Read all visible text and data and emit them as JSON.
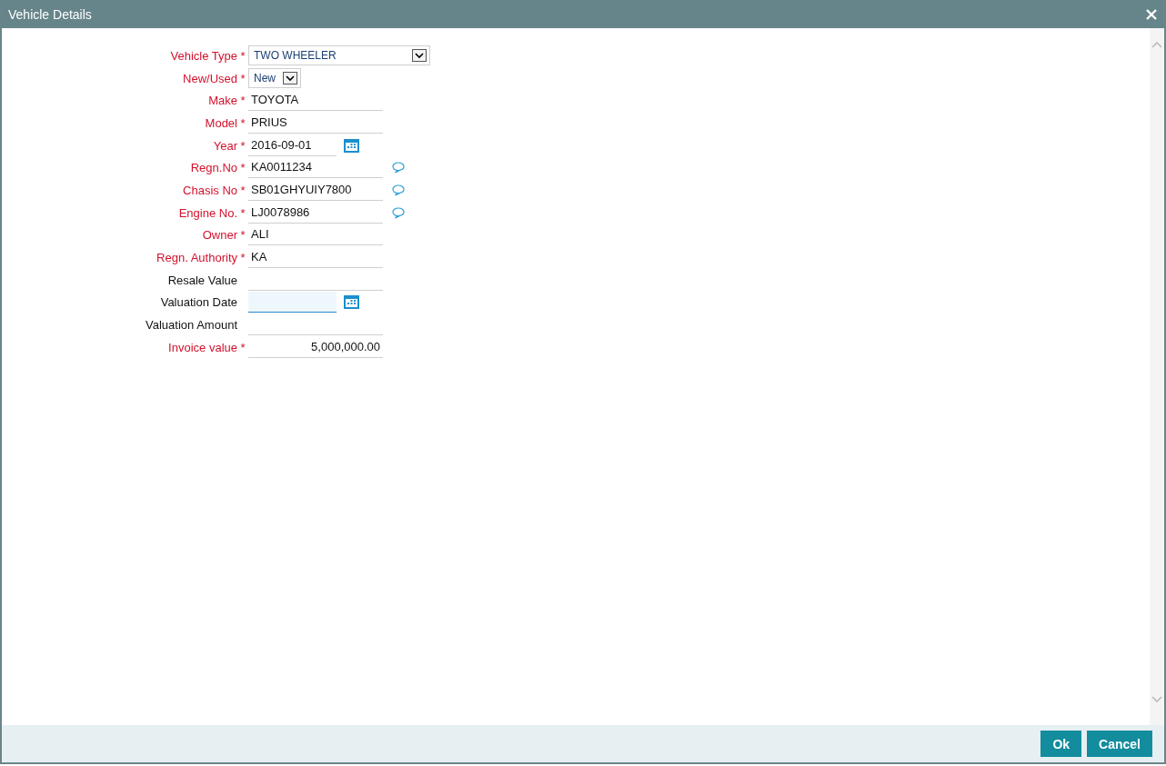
{
  "window": {
    "title": "Vehicle Details"
  },
  "fields": [
    {
      "label": "Vehicle Type",
      "required": true,
      "required_mark": "*",
      "kind": "select",
      "value": "TWO WHEELER",
      "note": false
    },
    {
      "label": "New/Used",
      "required": true,
      "required_mark": "*",
      "kind": "small_select",
      "value": "New",
      "note": false
    },
    {
      "label": "Make",
      "required": true,
      "required_mark": "*",
      "kind": "text",
      "value": "TOYOTA",
      "note": false,
      "focused": false
    },
    {
      "label": "Model",
      "required": true,
      "required_mark": "*",
      "kind": "text",
      "value": "PRIUS",
      "note": false,
      "focused": false
    },
    {
      "label": "Year",
      "required": true,
      "required_mark": "*",
      "kind": "date",
      "value": "2016-09-01",
      "note": false,
      "focused": false
    },
    {
      "label": "Regn.No",
      "required": true,
      "required_mark": "*",
      "kind": "text",
      "value": "KA0011234",
      "note": true,
      "focused": false
    },
    {
      "label": "Chasis No",
      "required": true,
      "required_mark": "*",
      "kind": "text",
      "value": "SB01GHYUIY7800",
      "note": true,
      "focused": false
    },
    {
      "label": "Engine No.",
      "required": true,
      "required_mark": "*",
      "kind": "text",
      "value": "LJ0078986",
      "note": true,
      "focused": false
    },
    {
      "label": "Owner",
      "required": true,
      "required_mark": "*",
      "kind": "text",
      "value": "ALI",
      "note": false,
      "focused": false
    },
    {
      "label": "Regn. Authority",
      "required": true,
      "required_mark": "*",
      "kind": "text",
      "value": "KA",
      "note": false,
      "focused": false
    },
    {
      "label": "Resale Value",
      "required": false,
      "kind": "text",
      "note": false,
      "focused": false
    },
    {
      "label": "Valuation Date",
      "required": false,
      "kind": "date",
      "note": false,
      "focused": true
    },
    {
      "label": "Valuation Amount",
      "required": false,
      "kind": "text",
      "note": false,
      "focused": false
    },
    {
      "label": "Invoice value",
      "required": true,
      "required_mark": "*",
      "kind": "number",
      "value": "5,000,000.00",
      "note": false,
      "focused": false
    }
  ],
  "buttons": [
    {
      "label": "Ok"
    },
    {
      "label": "Cancel"
    }
  ]
}
